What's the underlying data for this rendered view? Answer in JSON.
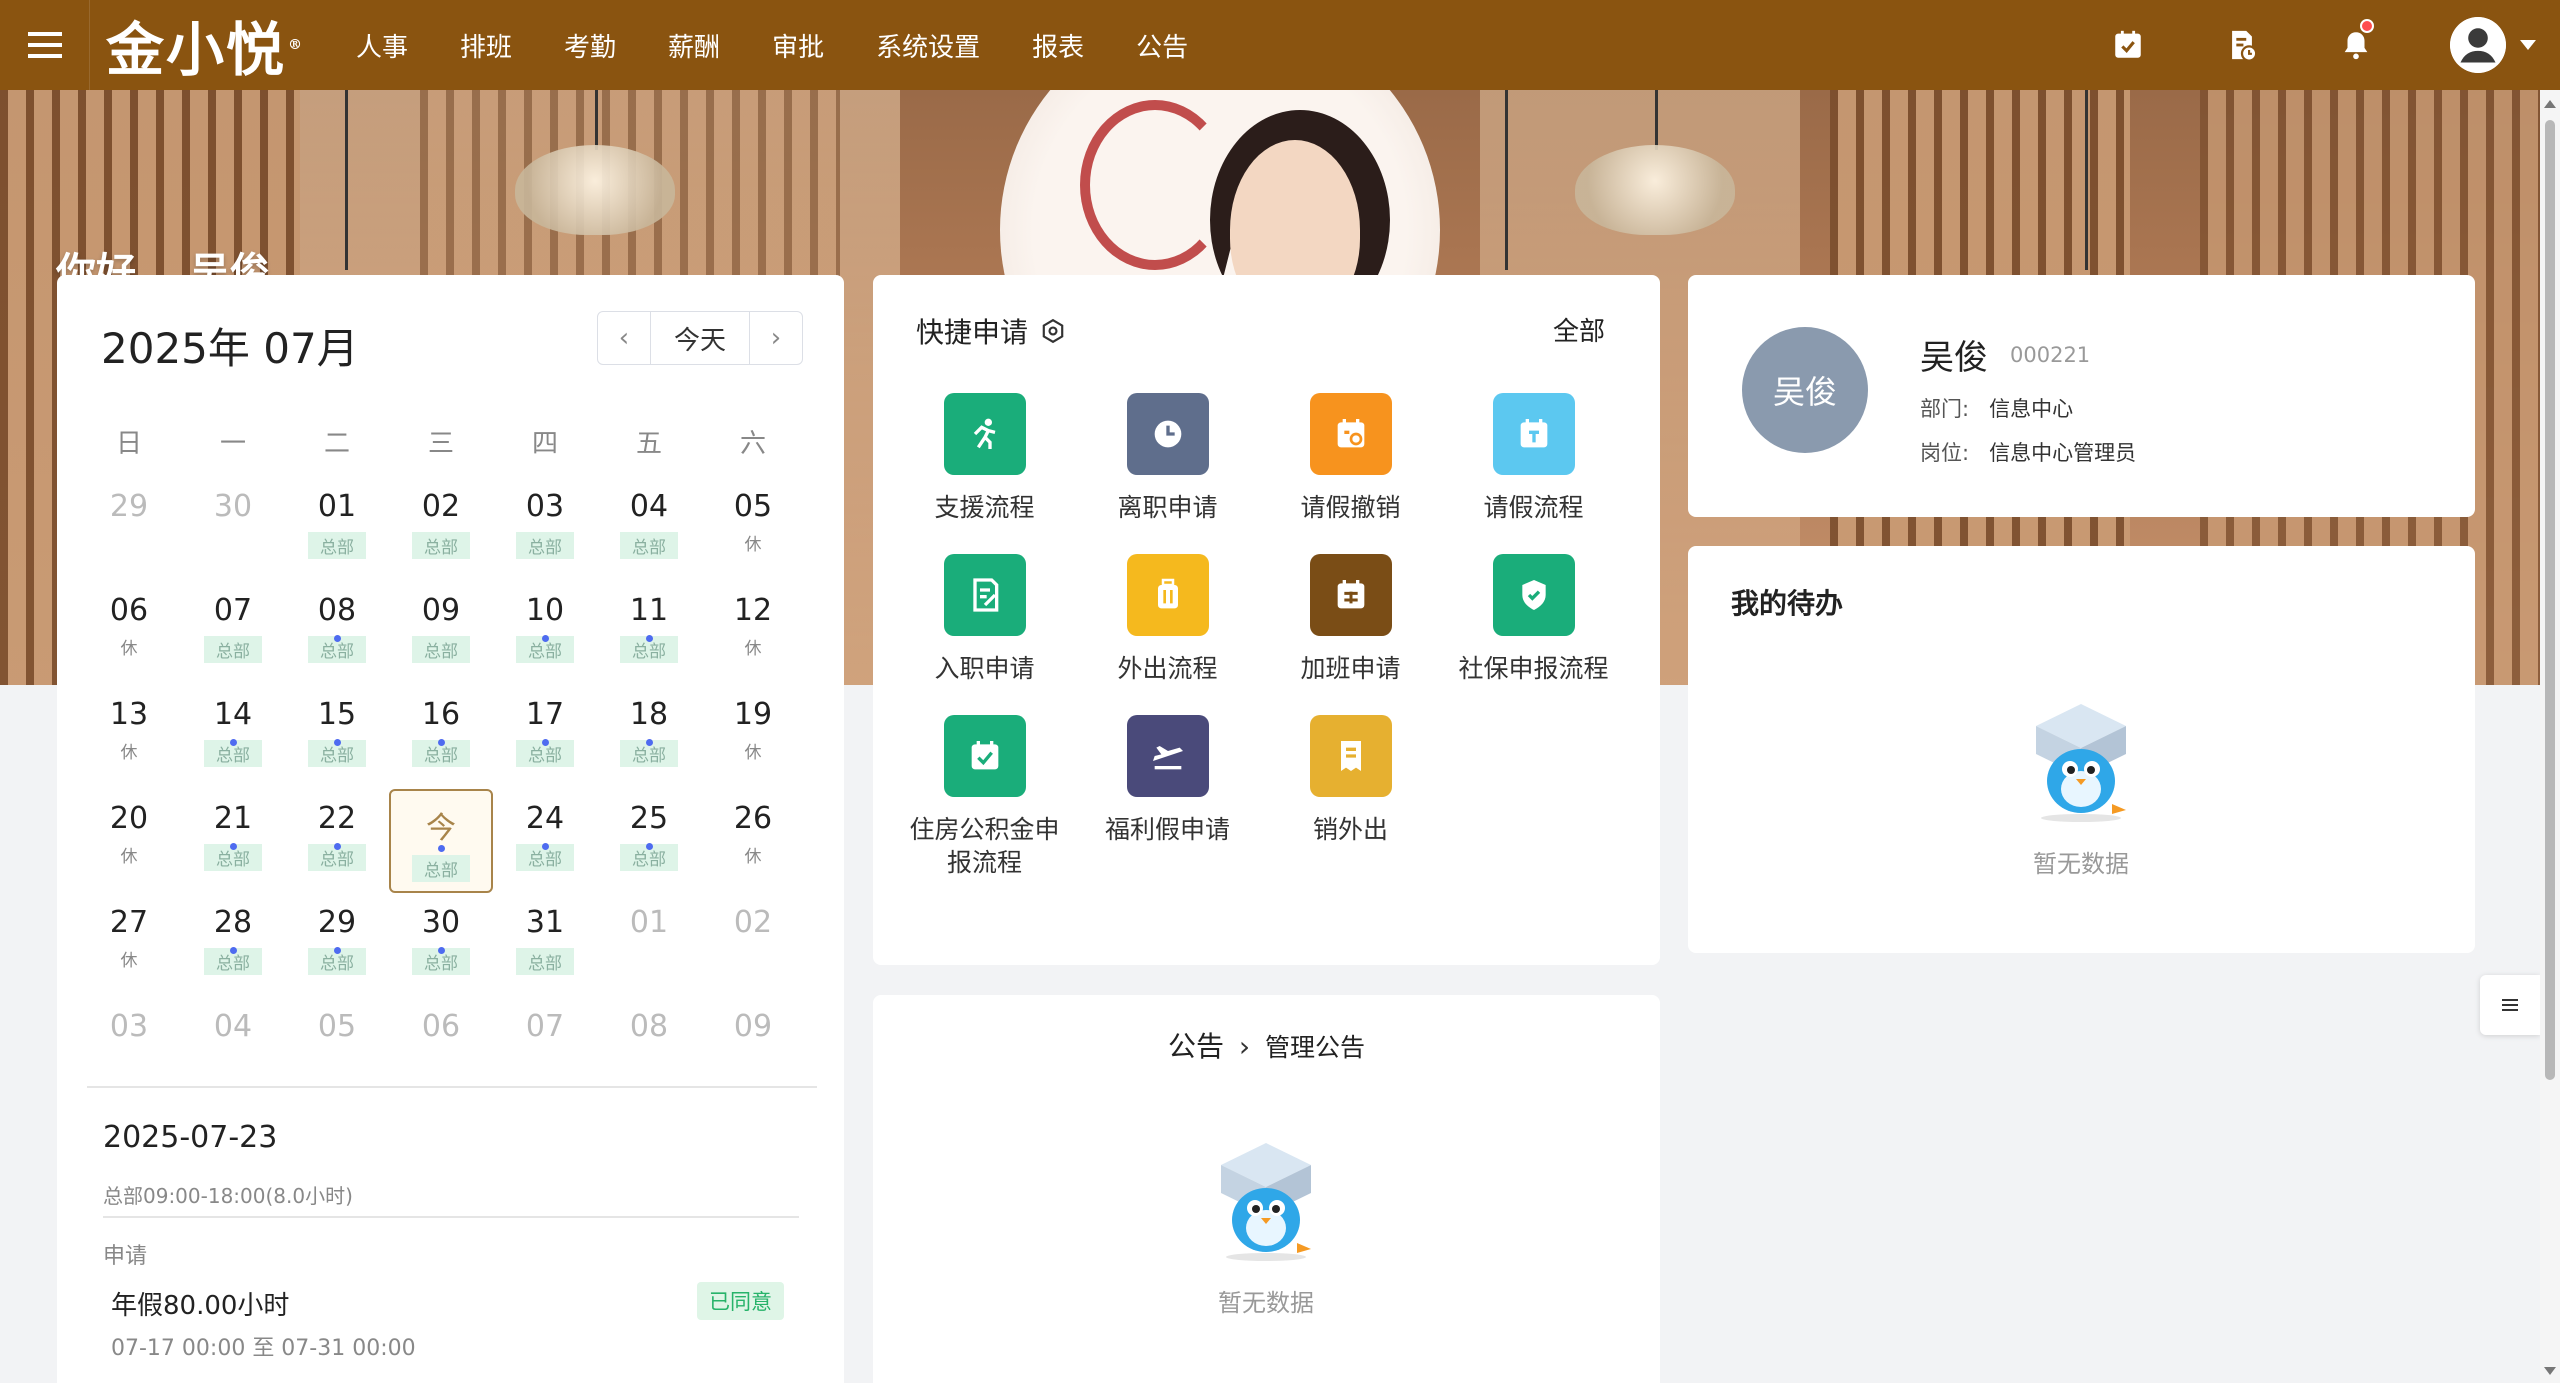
{
  "app": {
    "logo": "金小悦",
    "logo_mark": "®"
  },
  "nav": [
    "人事",
    "排班",
    "考勤",
    "薪酬",
    "审批",
    "系统设置",
    "报表",
    "公告"
  ],
  "greeting": "你好， 吴俊",
  "calendar": {
    "title": "2025年 07月",
    "today_label": "今天",
    "weekdays": [
      "日",
      "一",
      "二",
      "三",
      "四",
      "五",
      "六"
    ],
    "weeks": [
      [
        {
          "d": "29",
          "m": 1
        },
        {
          "d": "30",
          "m": 1
        },
        {
          "d": "01",
          "t": "总部"
        },
        {
          "d": "02",
          "t": "总部"
        },
        {
          "d": "03",
          "t": "总部"
        },
        {
          "d": "04",
          "t": "总部"
        },
        {
          "d": "05",
          "r": "休"
        }
      ],
      [
        {
          "d": "06",
          "r": "休"
        },
        {
          "d": "07",
          "t": "总部"
        },
        {
          "d": "08",
          "t": "总部",
          "dot": 1
        },
        {
          "d": "09",
          "t": "总部"
        },
        {
          "d": "10",
          "t": "总部",
          "dot": 1
        },
        {
          "d": "11",
          "t": "总部",
          "dot": 1
        },
        {
          "d": "12",
          "r": "休"
        }
      ],
      [
        {
          "d": "13",
          "r": "休"
        },
        {
          "d": "14",
          "t": "总部",
          "dot": 1
        },
        {
          "d": "15",
          "t": "总部",
          "dot": 1
        },
        {
          "d": "16",
          "t": "总部",
          "dot": 1
        },
        {
          "d": "17",
          "t": "总部",
          "dot": 1
        },
        {
          "d": "18",
          "t": "总部",
          "dot": 1
        },
        {
          "d": "19",
          "r": "休"
        }
      ],
      [
        {
          "d": "20",
          "r": "休"
        },
        {
          "d": "21",
          "t": "总部",
          "dot": 1
        },
        {
          "d": "22",
          "t": "总部",
          "dot": 1
        },
        {
          "d": "今",
          "t": "总部",
          "dot": 1,
          "today": 1
        },
        {
          "d": "24",
          "t": "总部",
          "dot": 1
        },
        {
          "d": "25",
          "t": "总部",
          "dot": 1
        },
        {
          "d": "26",
          "r": "休"
        }
      ],
      [
        {
          "d": "27",
          "r": "休"
        },
        {
          "d": "28",
          "t": "总部",
          "dot": 1
        },
        {
          "d": "29",
          "t": "总部",
          "dot": 1
        },
        {
          "d": "30",
          "t": "总部",
          "dot": 1
        },
        {
          "d": "31",
          "t": "总部"
        },
        {
          "d": "01",
          "m": 1
        },
        {
          "d": "02",
          "m": 1
        }
      ],
      [
        {
          "d": "03",
          "m": 1
        },
        {
          "d": "04",
          "m": 1
        },
        {
          "d": "05",
          "m": 1
        },
        {
          "d": "06",
          "m": 1
        },
        {
          "d": "07",
          "m": 1
        },
        {
          "d": "08",
          "m": 1
        },
        {
          "d": "09",
          "m": 1
        }
      ]
    ],
    "selected_date": "2025-07-23",
    "shift": "总部09:00-18:00(8.0小时)",
    "apply_label": "申请",
    "leave_title": "年假80.00小时",
    "leave_range": "07-17 00:00 至 07-31 00:00",
    "leave_status": "已同意"
  },
  "quick": {
    "title": "快捷申请",
    "all_label": "全部",
    "items": [
      {
        "label": "支援流程",
        "color": "#1aad7a",
        "icon": "run-icon"
      },
      {
        "label": "离职申请",
        "color": "#5f6e8c",
        "icon": "clock-icon"
      },
      {
        "label": "请假撤销",
        "color": "#f7931e",
        "icon": "calendar-cancel-icon"
      },
      {
        "label": "请假流程",
        "color": "#5cc8f0",
        "icon": "calendar-icon"
      },
      {
        "label": "入职申请",
        "color": "#1aad7a",
        "icon": "form-edit-icon"
      },
      {
        "label": "外出流程",
        "color": "#f5b91e",
        "icon": "luggage-icon"
      },
      {
        "label": "加班申请",
        "color": "#7a4d16",
        "icon": "overtime-icon"
      },
      {
        "label": "社保申报流程",
        "color": "#1aad7a",
        "icon": "shield-icon"
      },
      {
        "label": "住房公积金申报流程",
        "color": "#1aad7a",
        "icon": "checkbox-icon"
      },
      {
        "label": "福利假申请",
        "color": "#4a4a7a",
        "icon": "plane-icon"
      },
      {
        "label": "销外出",
        "color": "#e6b030",
        "icon": "receipt-icon"
      }
    ]
  },
  "notice": {
    "title": "公告",
    "sub": "管理公告",
    "empty": "暂无数据"
  },
  "profile": {
    "avatar_text": "吴俊",
    "name": "吴俊",
    "id": "000221",
    "dept_label": "部门:",
    "dept": "信息中心",
    "post_label": "岗位:",
    "post": "信息中心管理员"
  },
  "todo": {
    "title": "我的待办",
    "empty": "暂无数据"
  }
}
